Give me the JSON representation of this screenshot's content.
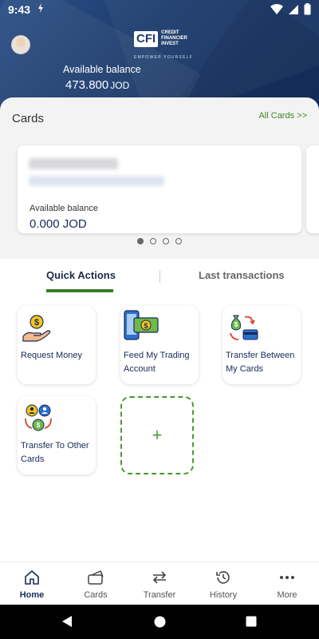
{
  "status_bar": {
    "time": "9:43",
    "sync_icon": "sync-icon"
  },
  "header": {
    "logo_mark": "CFI",
    "logo_text_lines": [
      "CREDIT",
      "FINANCIER",
      "INVEST"
    ],
    "logo_tagline": "EMPOWER YOURSELF",
    "available_balance_label": "Available balance",
    "balance_amount": "473.800",
    "balance_currency": "JOD"
  },
  "cards": {
    "title": "Cards",
    "all_cards_link": "All Cards >>",
    "card": {
      "available_label": "Available balance",
      "amount": "0.000 JOD"
    },
    "pager": {
      "count": 4,
      "active_index": 0
    }
  },
  "tabs": {
    "quick_actions": "Quick Actions",
    "last_transactions": "Last transactions",
    "active": "quick_actions"
  },
  "quick_actions": [
    {
      "label": "Request Money",
      "icon": "request-money-icon"
    },
    {
      "label": "Feed My Trading Account",
      "icon": "trading-account-icon"
    },
    {
      "label": "Transfer Between My Cards",
      "icon": "transfer-between-cards-icon"
    },
    {
      "label": "Transfer To Other Cards",
      "icon": "transfer-other-cards-icon"
    }
  ],
  "add_action": {
    "label": "+"
  },
  "bottom_nav": [
    {
      "label": "Home",
      "icon": "home-icon",
      "active": true
    },
    {
      "label": "Cards",
      "icon": "cards-icon",
      "active": false
    },
    {
      "label": "Transfer",
      "icon": "transfer-icon",
      "active": false
    },
    {
      "label": "History",
      "icon": "history-icon",
      "active": false
    },
    {
      "label": "More",
      "icon": "more-icon",
      "active": false
    }
  ],
  "colors": {
    "header_navy": "#1e3d6e",
    "accent_green": "#3d7a2e",
    "link_green": "#3c8a22",
    "text_navy": "#1a2a5a"
  }
}
